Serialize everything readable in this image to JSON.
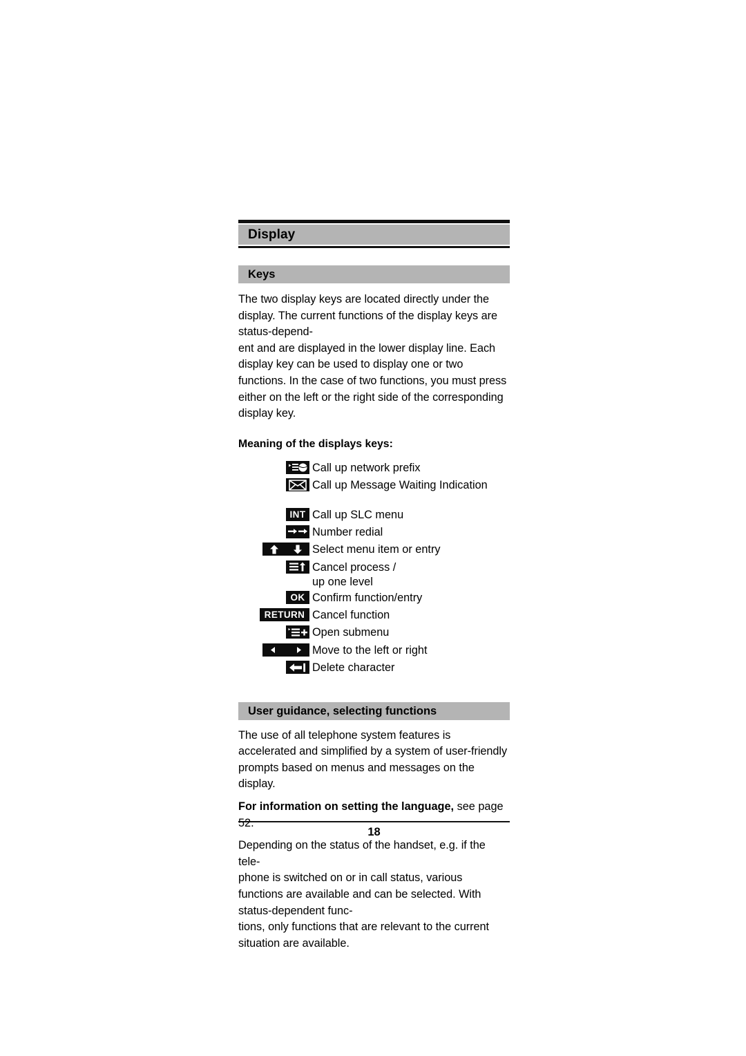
{
  "page": {
    "chapter_title": "Display",
    "page_number": "18"
  },
  "sections": {
    "keys": {
      "heading": "Keys",
      "intro": "The two display keys are located directly under the display. The current functions of the display keys are status-depend-\nent and are displayed in the lower display line. Each display key can be used to display one or two functions. In the case of two functions, you must press either on the left or the right side of the corresponding display key.",
      "lead_in": "Meaning of the displays keys:",
      "items": [
        {
          "icon": "menu-globe-icon",
          "label": "Call up network prefix"
        },
        {
          "icon": "envelope-icon",
          "label": "Call up Message Waiting Indication"
        },
        {
          "icon": "int-badge",
          "badge_text": "INT",
          "label": "Call up SLC menu"
        },
        {
          "icon": "double-right-arrow-icon",
          "label": "Number redial"
        },
        {
          "icon": "up-arrow-icon",
          "icon_left": "down-arrow-icon",
          "label": "Select menu item or entry"
        },
        {
          "icon": "menu-up-arrow-icon",
          "label": "Cancel process /\nup one level"
        },
        {
          "icon": "ok-badge",
          "badge_text": "OK",
          "label": "Confirm function/entry"
        },
        {
          "icon": "return-badge",
          "badge_text": "RETURN",
          "label": "Cancel function"
        },
        {
          "icon": "menu-plus-icon",
          "label": "Open submenu"
        },
        {
          "icon": "left-arrow-icon",
          "icon_left": "right-arrow-icon",
          "label": "Move to the left or right"
        },
        {
          "icon": "backspace-icon",
          "label": "Delete character"
        }
      ]
    },
    "guidance": {
      "heading": "User guidance, selecting functions",
      "paragraph_1": "The use of all telephone system features is accelerated and simplified by a system of user-friendly prompts based on menus and messages on the display.",
      "note_bold": "For information on setting the language,",
      "note_rest": " see page 52.",
      "paragraph_2": "Depending on the status of the handset, e.g. if the tele-\nphone is switched on or in call status, various functions are available and can be selected. With status-dependent func-\ntions, only functions that are relevant to the current situation are available."
    }
  },
  "colors": {
    "bar_grey": "#b4b4b4",
    "rule_black": "#111111",
    "badge_black": "#0d0d0d",
    "page_white": "#ffffff"
  }
}
